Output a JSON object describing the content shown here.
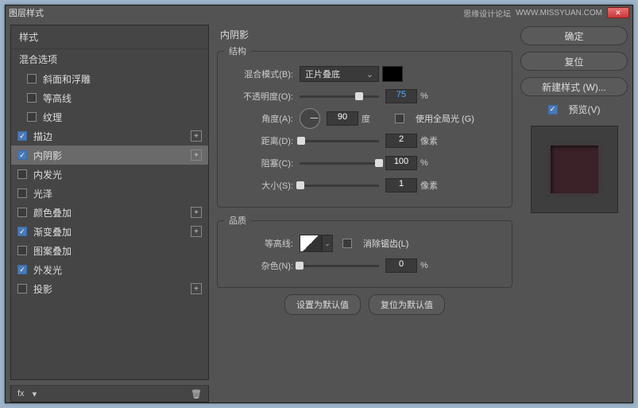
{
  "window": {
    "title": "图层样式"
  },
  "titlebar": {
    "forum": "思缘设计论坛",
    "url": "WWW.MISSYUAN.COM"
  },
  "left": {
    "styles_header": "样式",
    "blend_header": "混合选项",
    "items": [
      {
        "label": "斜面和浮雕",
        "checked": false,
        "indent": true,
        "plus": false
      },
      {
        "label": "等高线",
        "checked": false,
        "indent": true,
        "plus": false
      },
      {
        "label": "纹理",
        "checked": false,
        "indent": true,
        "plus": false
      },
      {
        "label": "描边",
        "checked": true,
        "indent": false,
        "plus": true
      },
      {
        "label": "内阴影",
        "checked": true,
        "indent": false,
        "plus": true,
        "selected": true
      },
      {
        "label": "内发光",
        "checked": false,
        "indent": false,
        "plus": false
      },
      {
        "label": "光泽",
        "checked": false,
        "indent": false,
        "plus": false
      },
      {
        "label": "颜色叠加",
        "checked": false,
        "indent": false,
        "plus": true
      },
      {
        "label": "渐变叠加",
        "checked": true,
        "indent": false,
        "plus": true
      },
      {
        "label": "图案叠加",
        "checked": false,
        "indent": false,
        "plus": false
      },
      {
        "label": "外发光",
        "checked": true,
        "indent": false,
        "plus": false
      },
      {
        "label": "投影",
        "checked": false,
        "indent": false,
        "plus": true
      }
    ]
  },
  "center": {
    "title": "内阴影",
    "structure": {
      "legend": "结构",
      "blend_mode_label": "混合模式(B):",
      "blend_mode_value": "正片叠底",
      "opacity_label": "不透明度(O):",
      "opacity_value": "75",
      "opacity_unit": "%",
      "angle_label": "角度(A):",
      "angle_value": "90",
      "angle_unit": "度",
      "global_light": "使用全局光 (G)",
      "distance_label": "距离(D):",
      "distance_value": "2",
      "distance_unit": "像素",
      "choke_label": "阻塞(C):",
      "choke_value": "100",
      "choke_unit": "%",
      "size_label": "大小(S):",
      "size_value": "1",
      "size_unit": "像素"
    },
    "quality": {
      "legend": "品质",
      "contour_label": "等高线:",
      "antialias": "消除锯齿(L)",
      "noise_label": "杂色(N):",
      "noise_value": "0",
      "noise_unit": "%"
    },
    "buttons": {
      "default": "设置为默认值",
      "reset": "复位为默认值"
    }
  },
  "right": {
    "ok": "确定",
    "cancel": "复位",
    "new_style": "新建样式 (W)...",
    "preview": "预览(V)"
  },
  "footer": {
    "fx": "fx"
  }
}
